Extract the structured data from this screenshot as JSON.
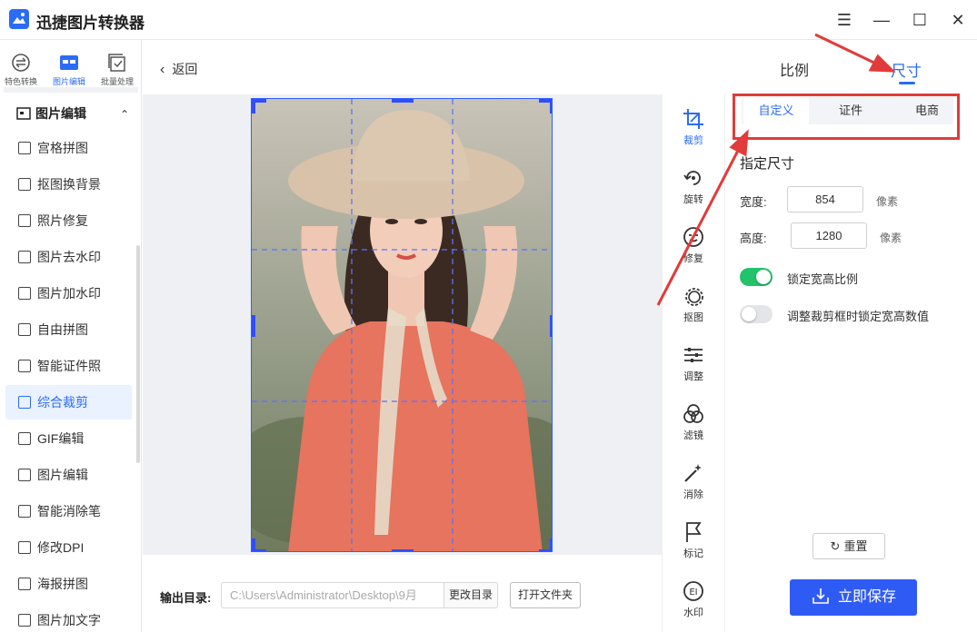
{
  "app": {
    "title": "迅捷图片转换器"
  },
  "window_controls": {
    "menu": "☰",
    "minimize": "—",
    "maximize": "☐",
    "close": "✕"
  },
  "top_nav": [
    {
      "label": "特色转换",
      "icon": "convert-icon"
    },
    {
      "label": "图片编辑",
      "icon": "edit-icon"
    },
    {
      "label": "批量处理",
      "icon": "batch-icon"
    }
  ],
  "sidebar": {
    "section_title": "图片编辑",
    "collapse_glyph": "⌃",
    "items": [
      {
        "label": "宫格拼图"
      },
      {
        "label": "抠图换背景"
      },
      {
        "label": "照片修复"
      },
      {
        "label": "图片去水印"
      },
      {
        "label": "图片加水印"
      },
      {
        "label": "自由拼图"
      },
      {
        "label": "智能证件照"
      },
      {
        "label": "综合裁剪"
      },
      {
        "label": "GIF编辑"
      },
      {
        "label": "图片编辑"
      },
      {
        "label": "智能消除笔"
      },
      {
        "label": "修改DPI"
      },
      {
        "label": "海报拼图"
      },
      {
        "label": "图片加文字"
      }
    ],
    "active_index": 7
  },
  "header": {
    "back_label": "返回",
    "back_glyph": "‹"
  },
  "right_tabs": {
    "ratio": "比例",
    "size": "尺寸",
    "active": "size"
  },
  "output": {
    "label": "输出目录:",
    "path": "C:\\Users\\Administrator\\Desktop\\9月",
    "change_dir": "更改目录",
    "open_folder": "打开文件夹"
  },
  "tools": [
    {
      "label": "裁剪",
      "icon": "crop-icon"
    },
    {
      "label": "旋转",
      "icon": "rotate-icon"
    },
    {
      "label": "修复",
      "icon": "repair-icon"
    },
    {
      "label": "抠图",
      "icon": "cutout-icon"
    },
    {
      "label": "调整",
      "icon": "adjust-icon"
    },
    {
      "label": "滤镜",
      "icon": "filter-icon"
    },
    {
      "label": "消除",
      "icon": "eraser-icon"
    },
    {
      "label": "标记",
      "icon": "flag-icon"
    },
    {
      "label": "水印",
      "icon": "watermark-icon"
    }
  ],
  "presets": {
    "custom": "自定义",
    "id_photo": "证件",
    "ecommerce": "电商",
    "active": "custom"
  },
  "size_panel": {
    "title": "指定尺寸",
    "width_label": "宽度:",
    "width_value": "854",
    "height_label": "高度:",
    "height_value": "1280",
    "unit": "像素",
    "lock_ratio_label": "锁定宽高比例",
    "lock_ratio_on": true,
    "lock_values_label": "调整裁剪框时锁定宽高数值",
    "lock_values_on": false
  },
  "actions": {
    "reset": "重置",
    "save": "立即保存"
  },
  "colors": {
    "accent": "#2b6cf6",
    "save": "#2f5bf5",
    "toggle_on": "#22c36b",
    "annotation": "#e23b3b"
  }
}
